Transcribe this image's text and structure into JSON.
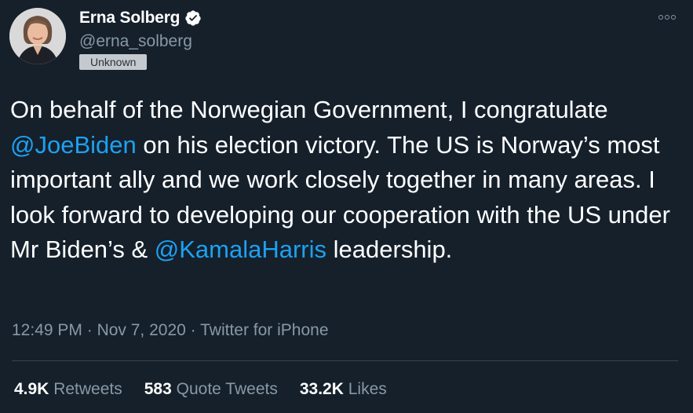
{
  "author": {
    "name": "Erna Solberg",
    "handle": "@erna_solberg",
    "badge": "Unknown",
    "verified_icon": "verified-badge-icon"
  },
  "tweet": {
    "text_1": "On behalf of the Norwegian Government, I congratulate ",
    "mention_1": "@JoeBiden",
    "text_2": " on his election victory. The US is Norway’s most important ally and we work closely together in many areas. I look forward to developing our cooperation with the US under Mr Biden’s & ",
    "mention_2": "@KamalaHarris",
    "text_3": " leadership."
  },
  "meta": {
    "time": "12:49 PM",
    "sep1": " · ",
    "date": "Nov 7, 2020",
    "sep2": " · ",
    "source": "Twitter for iPhone"
  },
  "stats": {
    "retweets_count": "4.9K",
    "retweets_label": "Retweets",
    "quotes_count": "583",
    "quotes_label": "Quote Tweets",
    "likes_count": "33.2K",
    "likes_label": "Likes"
  },
  "colors": {
    "background": "#15202b",
    "link": "#1da1f2",
    "muted": "#8899a6"
  }
}
